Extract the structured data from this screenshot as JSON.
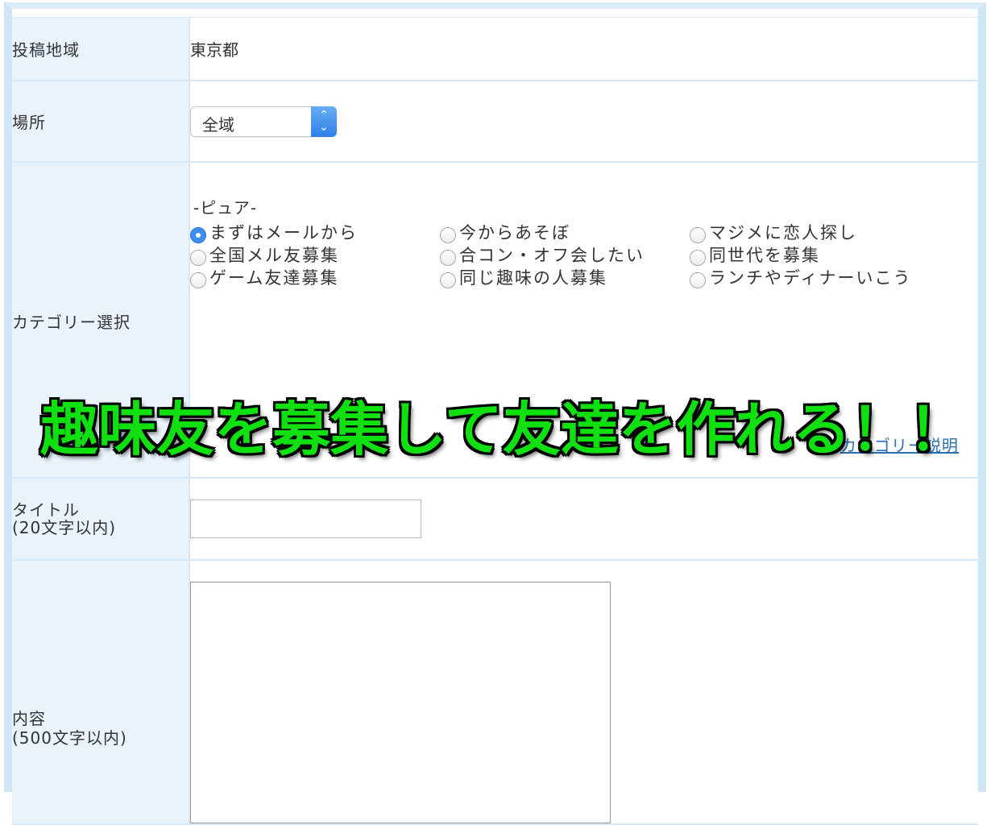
{
  "form": {
    "region": {
      "label": "投稿地域",
      "value": "東京都"
    },
    "place": {
      "label": "場所",
      "selected": "全域"
    },
    "category": {
      "label": "カテゴリー選択",
      "group_title": "-ピュア-",
      "options": [
        {
          "label": "まずはメールから",
          "checked": true
        },
        {
          "label": "今からあそぼ",
          "checked": false
        },
        {
          "label": "マジメに恋人探し",
          "checked": false
        },
        {
          "label": "全国メル友募集",
          "checked": false
        },
        {
          "label": "合コン・オフ会したい",
          "checked": false
        },
        {
          "label": "同世代を募集",
          "checked": false
        },
        {
          "label": "ゲーム友達募集",
          "checked": false
        },
        {
          "label": "同じ趣味の人募集",
          "checked": false
        },
        {
          "label": "ランチやディナーいこう",
          "checked": false
        }
      ],
      "link": "カテゴリー説明"
    },
    "title": {
      "label_line1": "タイトル",
      "label_line2": "(20文字以内)",
      "value": ""
    },
    "content": {
      "label_line1": "内容",
      "label_line2": "(500文字以内)",
      "value": ""
    }
  },
  "overlay_caption": "趣味友を募集して友達を作れる！！",
  "colors": {
    "label_bg": "#e9f3fc",
    "border": "#d8e7f4",
    "caption": "#10e010",
    "link": "#2a6fb5",
    "radio_selected": "#3d8ef0"
  }
}
